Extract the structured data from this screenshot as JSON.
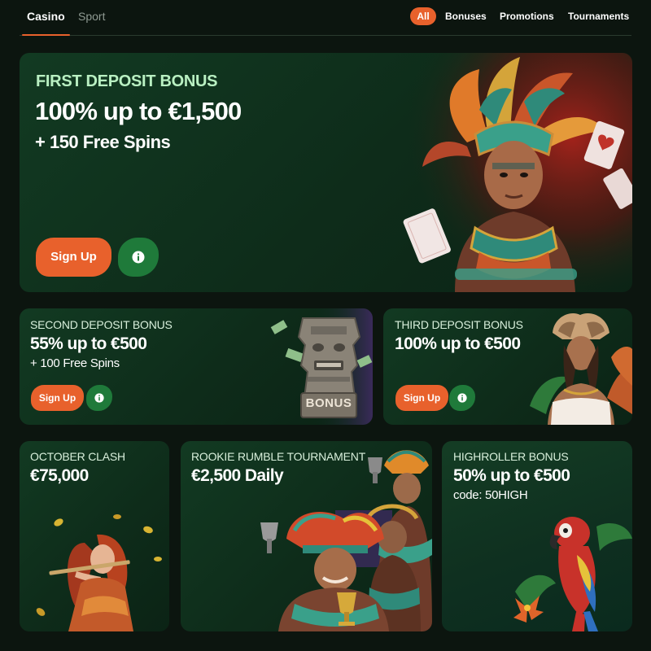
{
  "nav": {
    "tabs": [
      "Casino",
      "Sport"
    ],
    "active_tab": "Casino",
    "filters": [
      "All",
      "Bonuses",
      "Promotions",
      "Tournaments"
    ],
    "active_filter": "All"
  },
  "hero": {
    "eyebrow": "FIRST DEPOSIT BONUS",
    "headline": "100% up to €1,500",
    "subline": "+ 150 Free Spins",
    "signup_label": "Sign Up",
    "info_icon": "info-icon"
  },
  "second": {
    "eyebrow": "SECOND DEPOSIT BONUS",
    "headline": "55% up to €500",
    "subline": "+ 100 Free Spins",
    "signup_label": "Sign Up",
    "stamp_text": "BONUS"
  },
  "third": {
    "eyebrow": "THIRD DEPOSIT BONUS",
    "headline": "100% up to €500",
    "signup_label": "Sign Up"
  },
  "october": {
    "eyebrow": "OCTOBER CLASH",
    "headline": "€75,000"
  },
  "rookie": {
    "eyebrow": "ROOKIE RUMBLE TOURNAMENT",
    "headline": "€2,500 Daily"
  },
  "highroller": {
    "eyebrow": "HIGHROLLER BONUS",
    "headline": "50% up to €500",
    "code": "code: 50HIGH"
  },
  "colors": {
    "accent": "#e8612c",
    "info_green": "#1f7a3a",
    "eyebrow_green": "#b9f0c2",
    "background": "#0c150f"
  }
}
